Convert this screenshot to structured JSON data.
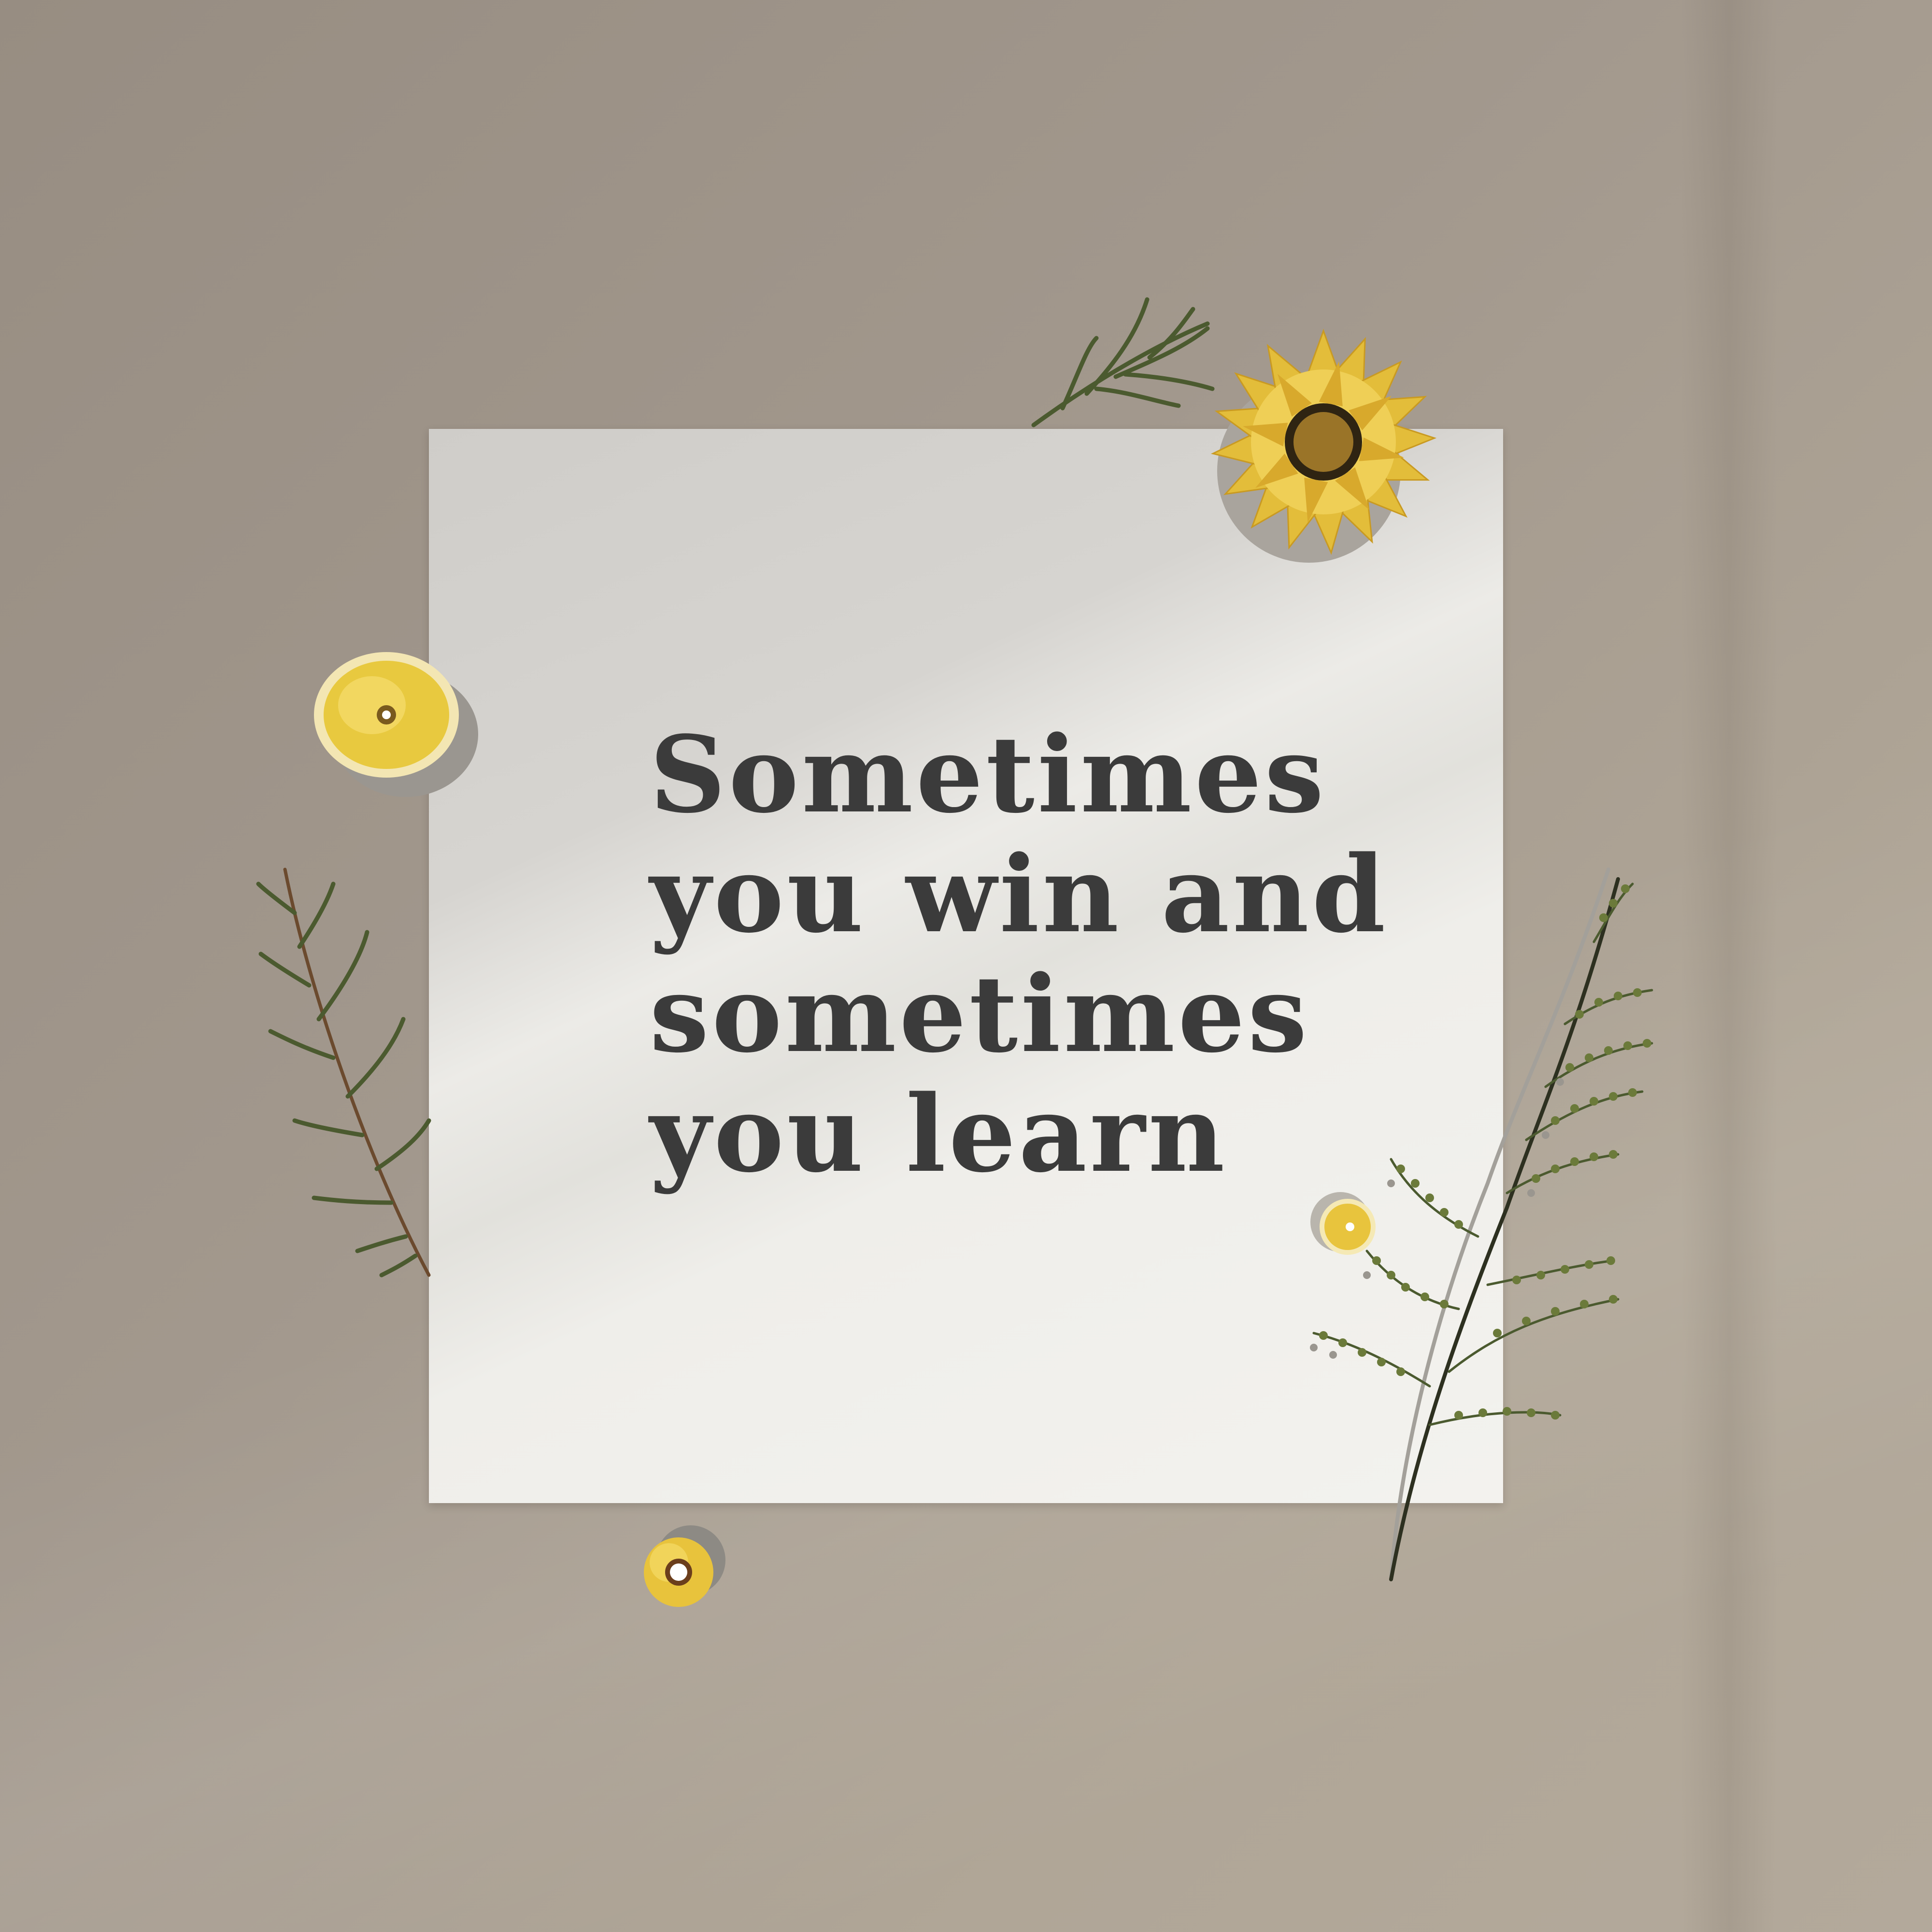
{
  "quote": {
    "lines": [
      "Sometimes",
      "you win and",
      "sometimes",
      "you learn"
    ]
  },
  "colors": {
    "wall": "#a39a8f",
    "paper": "#efeeea",
    "text": "#3b3b3b",
    "flower_yellow": "#e8c23f",
    "flower_center": "#6e4f1c",
    "leaf_green": "#4b5a2f"
  }
}
